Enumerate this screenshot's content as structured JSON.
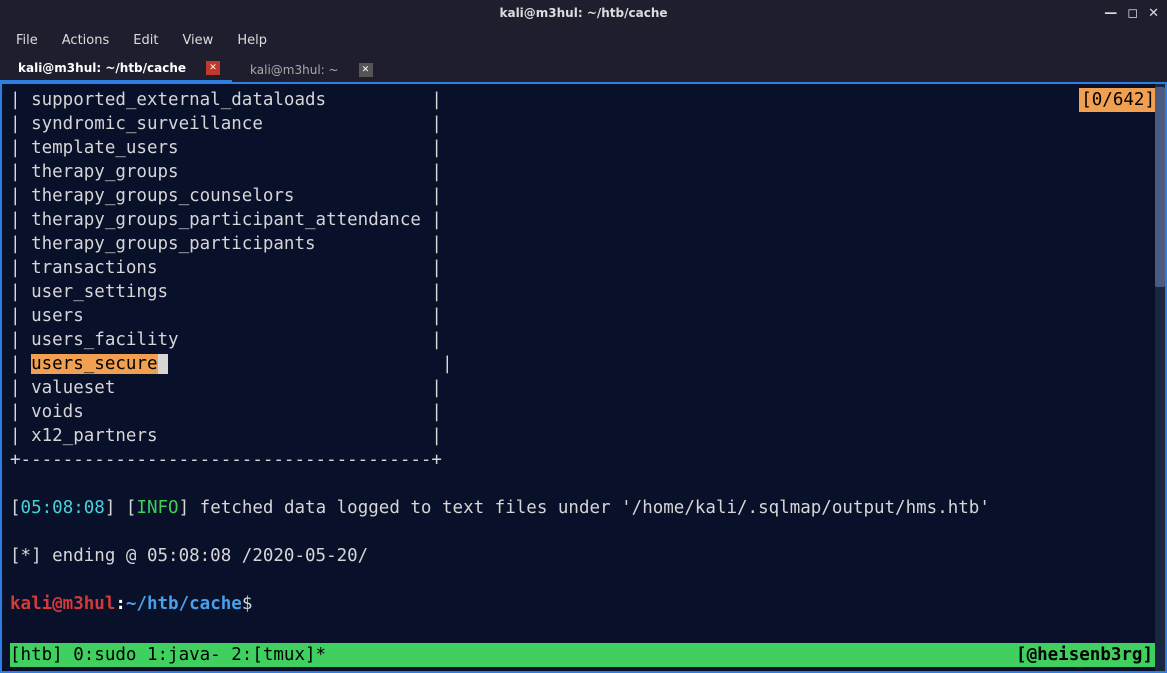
{
  "window": {
    "title": "kali@m3hul: ~/htb/cache"
  },
  "menu": {
    "file": "File",
    "actions": "Actions",
    "edit": "Edit",
    "view": "View",
    "help": "Help"
  },
  "tabs": [
    {
      "label": "kali@m3hul: ~/htb/cache",
      "active": true
    },
    {
      "label": "kali@m3hul: ~",
      "active": false
    }
  ],
  "counter": "[0/642]",
  "table_rows": [
    "supported_external_dataloads",
    "syndromic_surveillance",
    "template_users",
    "therapy_groups",
    "therapy_groups_counselors",
    "therapy_groups_participant_attendance",
    "therapy_groups_participants",
    "transactions",
    "user_settings",
    "users",
    "users_facility",
    "users_secure",
    "valueset",
    "voids",
    "x12_partners"
  ],
  "highlight_row": "users_secure",
  "table_end": "+---------------------------------------+",
  "log": {
    "time_open": "[",
    "time": "05:08:08",
    "time_close": "]",
    "info_open": " [",
    "info": "INFO",
    "info_close": "] ",
    "msg": "fetched data logged to text files under '/home/kali/.sqlmap/output/hms.htb'"
  },
  "ending": "[*] ending @ 05:08:08 /2020-05-20/",
  "prompt": {
    "user": "kali@m3hul",
    "colon": ":",
    "tilde": "~",
    "path": "/htb/cache",
    "dollar": "$"
  },
  "status": {
    "left": "[htb] 0:sudo  1:java- 2:[tmux]*",
    "right": "[@heisenb3rg]"
  }
}
